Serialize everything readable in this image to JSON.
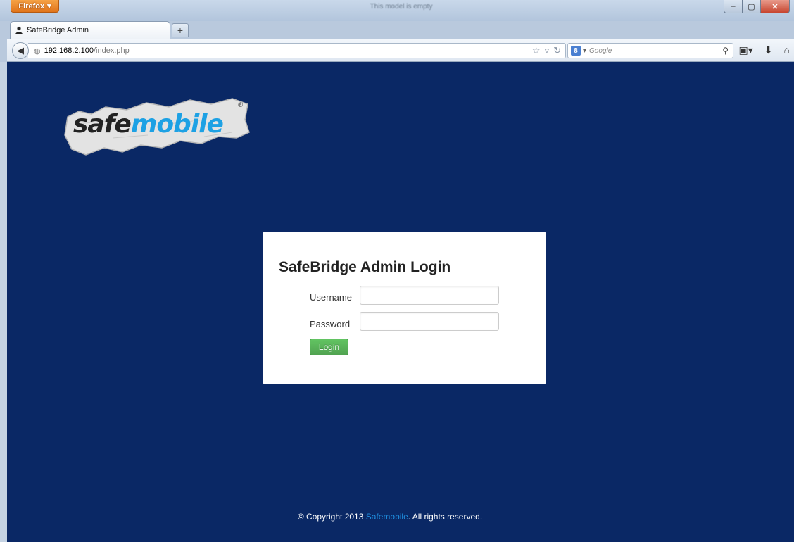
{
  "browser": {
    "menu_button": "Firefox",
    "window_title": "This model is empty",
    "tab_title": "SafeBridge Admin",
    "new_tab": "+",
    "url_host": "192.168.2.100",
    "url_path": "/index.php",
    "search_placeholder": "Google",
    "search_engine_letter": "8"
  },
  "page": {
    "logo": {
      "text_safe": "safe",
      "text_mobile": "mobile",
      "registered": "®"
    },
    "login": {
      "title": "SafeBridge Admin Login",
      "username_label": "Username",
      "username_value": "",
      "password_label": "Password",
      "password_value": "",
      "button": "Login"
    },
    "footer": {
      "prefix": "© Copyright 2013 ",
      "link": "Safemobile",
      "suffix": ". All rights reserved."
    }
  },
  "colors": {
    "page_background": "#0a2865",
    "login_button": "#5bb75b",
    "brand_blue": "#1da1e4"
  }
}
